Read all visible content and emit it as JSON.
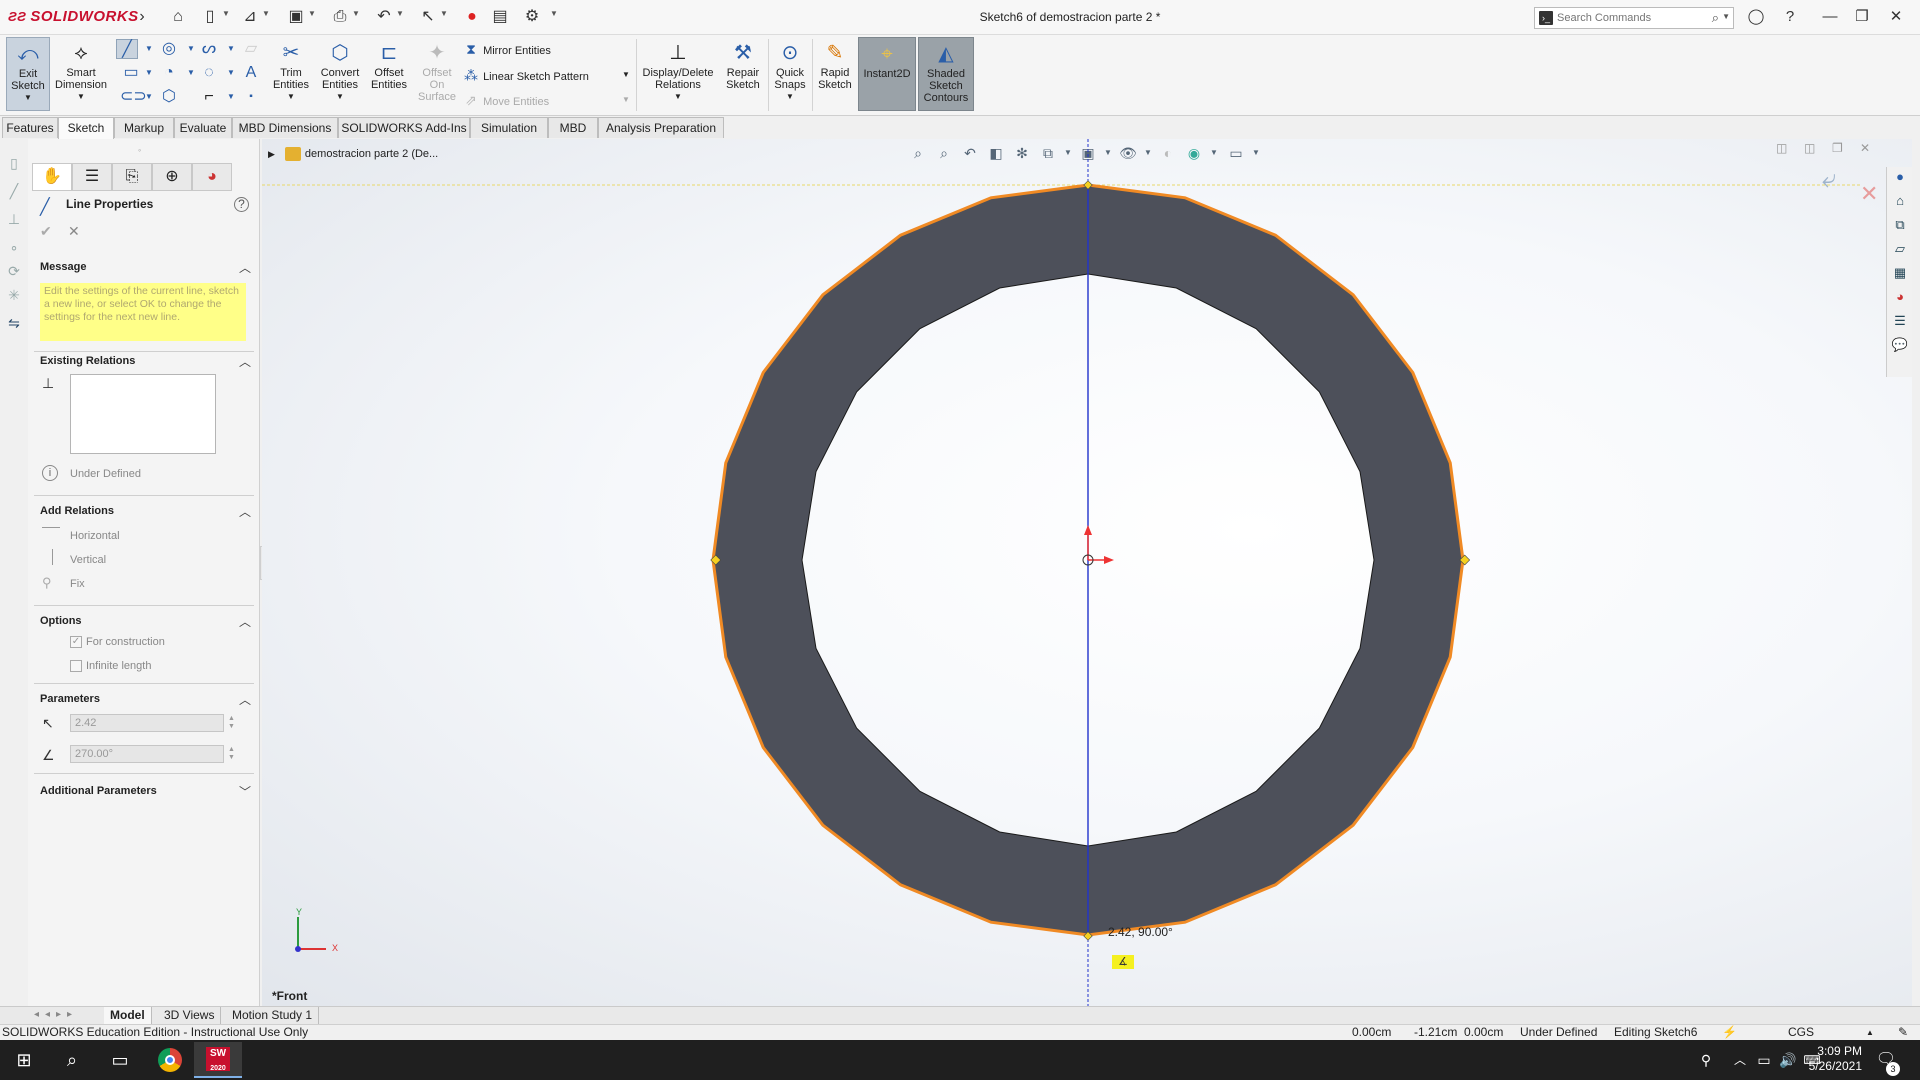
{
  "app": {
    "logo_text": "SOLIDWORKS",
    "doc_title": "Sketch6 of demostracion parte 2 *"
  },
  "search": {
    "placeholder": "Search Commands"
  },
  "ribbon": {
    "exit_sketch": "Exit Sketch",
    "smart_dimension": "Smart Dimension",
    "trim_entities": "Trim Entities",
    "convert_entities": "Convert Entities",
    "offset_entities": "Offset Entities",
    "offset_on_surface": "Offset On Surface",
    "mirror_entities": "Mirror Entities",
    "linear_sketch_pattern": "Linear Sketch Pattern",
    "move_entities": "Move Entities",
    "display_delete_relations": "Display/Delete Relations",
    "repair_sketch": "Repair Sketch",
    "quick_snaps": "Quick Snaps",
    "rapid_sketch": "Rapid Sketch",
    "instant2d": "Instant2D",
    "shaded_sketch_contours": "Shaded Sketch Contours"
  },
  "tabs": [
    "Features",
    "Sketch",
    "Markup",
    "Evaluate",
    "MBD Dimensions",
    "SOLIDWORKS Add-Ins",
    "Simulation",
    "MBD",
    "Analysis Preparation"
  ],
  "property_manager": {
    "title": "Line Properties",
    "message_heading": "Message",
    "message_text": "Edit the settings of the current line, sketch a new line, or select OK to change the settings for the next new line.",
    "existing_relations_heading": "Existing Relations",
    "status": "Under Defined",
    "add_relations_heading": "Add Relations",
    "relations": [
      "Horizontal",
      "Vertical",
      "Fix"
    ],
    "options_heading": "Options",
    "for_construction": "For construction",
    "infinite_length": "Infinite length",
    "parameters_heading": "Parameters",
    "length_value": "2.42",
    "angle_value": "270.00°",
    "additional_parameters_heading": "Additional Parameters"
  },
  "graphics": {
    "tree_root": "demostracion parte 2  (De...",
    "view_label": "*Front",
    "dimension_readout": "2.42, 90.00°",
    "axis_x": "X",
    "axis_y": "Y",
    "ring_fill": "#4d505a",
    "outline_color": "#f08a24",
    "centerline_color": "#2233cc"
  },
  "bottom_tabs": [
    "Model",
    "3D Views",
    "Motion Study 1"
  ],
  "status": {
    "edition": "SOLIDWORKS Education Edition - Instructional Use Only",
    "x": "0.00cm",
    "y": "-1.21cm",
    "z": "0.00cm",
    "definition": "Under Defined",
    "editing": "Editing Sketch6",
    "units": "CGS"
  },
  "taskbar": {
    "time": "3:09 PM",
    "date": "5/26/2021",
    "sw_badge": "2020",
    "notif_count": "3"
  }
}
